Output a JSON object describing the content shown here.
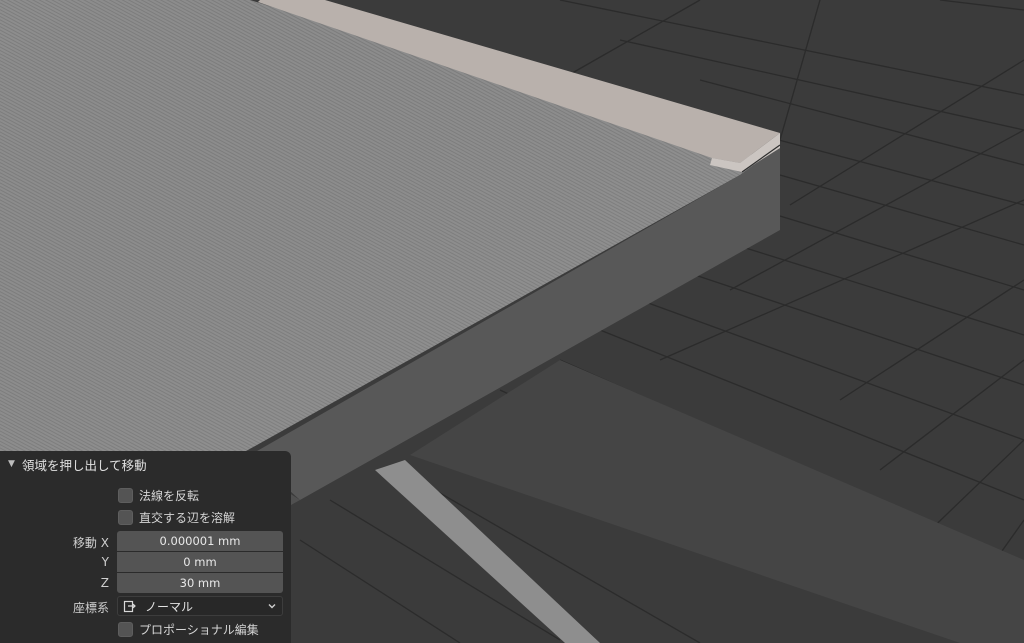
{
  "viewport": {
    "label": "3d-viewport"
  },
  "redo_panel": {
    "title": "領域を押し出して移動",
    "flip_normals_label": "法線を反転",
    "flip_normals_checked": false,
    "dissolve_edges_label": "直交する辺を溶解",
    "dissolve_edges_checked": false,
    "move_label": "移動",
    "move_x_label": "X",
    "move_x_value": "0.000001 mm",
    "move_y_label": "Y",
    "move_y_value": "0 mm",
    "move_z_label": "Z",
    "move_z_value": "30 mm",
    "orientation_label": "座標系",
    "orientation_value": "ノーマル",
    "proportional_label": "プロポーショナル編集",
    "proportional_checked": false
  },
  "icons": {
    "collapse": "triangle-down-icon",
    "orientation": "orientation-normal-icon",
    "dropdown": "chevron-down-icon"
  },
  "colors": {
    "panel_bg": "#2b2b2b",
    "field_bg": "#545454",
    "viewport_bg": "#3a3a3a",
    "grid_line": "#2a2a2a"
  }
}
